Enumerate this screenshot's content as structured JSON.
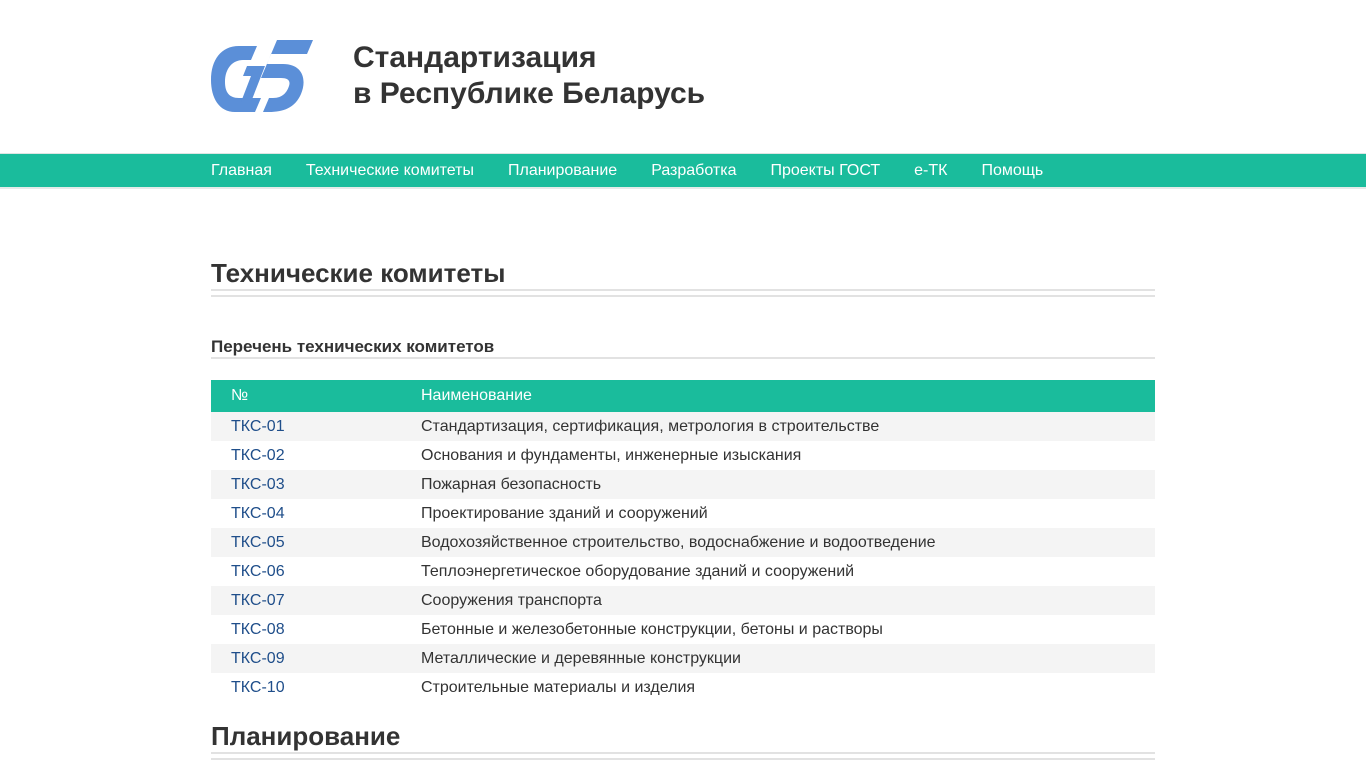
{
  "header": {
    "title_line1": "Стандартизация",
    "title_line2": "в Республике Беларусь",
    "logo_icon": "stb-logo-icon"
  },
  "nav": {
    "items": [
      "Главная",
      "Технические комитеты",
      "Планирование",
      "Разработка",
      "Проекты ГОСТ",
      "e-ТК",
      "Помощь"
    ]
  },
  "main": {
    "section1_title": "Технические комитеты",
    "subheading": "Перечень технических комитетов",
    "table": {
      "headers": [
        "№",
        "Наименование"
      ],
      "rows": [
        [
          "ТКС-01",
          "Стандартизация, сертификация, метрология в строительстве"
        ],
        [
          "ТКС-02",
          "Основания и фундаменты, инженерные изыскания"
        ],
        [
          "ТКС-03",
          "Пожарная безопасность"
        ],
        [
          "ТКС-04",
          "Проектирование зданий и сооружений"
        ],
        [
          "ТКС-05",
          "Водохозяйственное строительство, водоснабжение и водоотведение"
        ],
        [
          "ТКС-06",
          "Теплоэнергетическое оборудование зданий и сооружений"
        ],
        [
          "ТКС-07",
          "Сооружения транспорта"
        ],
        [
          "ТКС-08",
          "Бетонные и железобетонные конструкции, бетоны и растворы"
        ],
        [
          "ТКС-09",
          "Металлические и деревянные конструкции"
        ],
        [
          "ТКС-10",
          "Строительные материалы и изделия"
        ]
      ]
    },
    "section2_title": "Планирование"
  },
  "colors": {
    "accent": "#1abc9c",
    "logo": "#5b8fd8",
    "link": "#1f4e8a"
  }
}
